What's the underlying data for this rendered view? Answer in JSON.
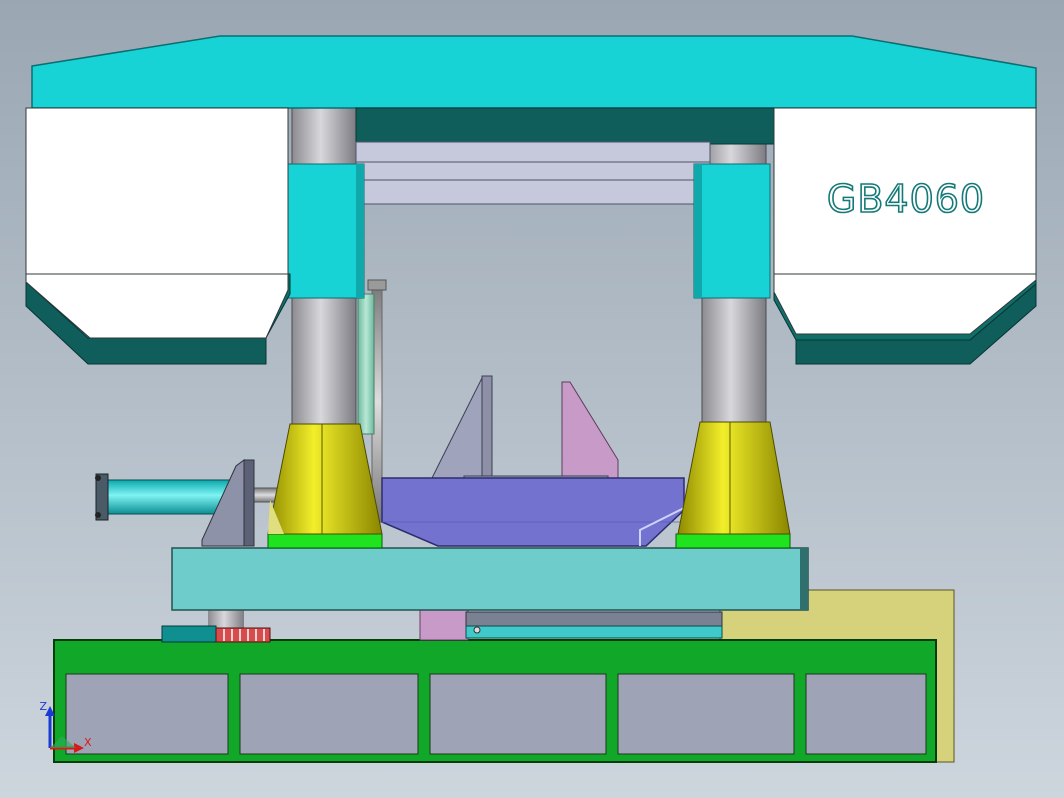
{
  "model_label": "GB4060",
  "triad": {
    "z_label": "Z",
    "x_label": "X"
  },
  "colors": {
    "background_top": "#9aa7b3",
    "background_bottom": "#cdd5dd",
    "cyan": "#18d3d6",
    "dark_teal": "#0f5e5b",
    "white_panel": "#ffffff",
    "column_gray": "#a9a9ae",
    "blade_guide": "#c6c9dc",
    "yellow_cone": "#c8c400",
    "green_base": "#11a829",
    "bright_green": "#1fe31f",
    "table_teal": "#6ecccb",
    "vise_purple": "#7373cf",
    "pink": "#c89ac8",
    "olive_box": "#d6d27c",
    "frame_gray": "#9ea3b6"
  }
}
